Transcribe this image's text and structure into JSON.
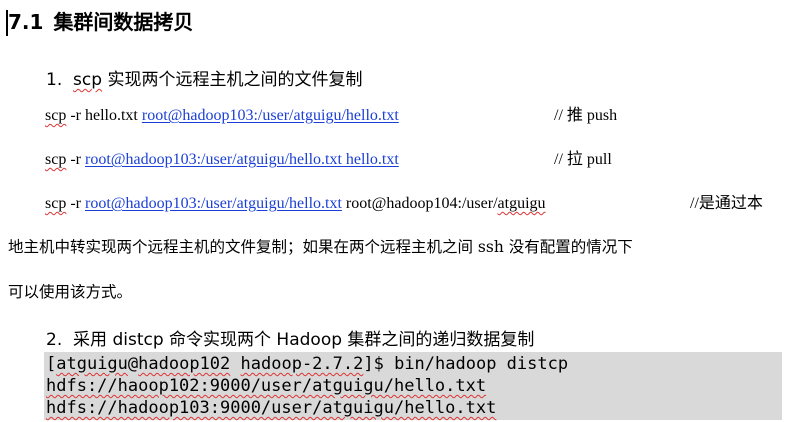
{
  "section": {
    "number": "7.1",
    "title": "集群间数据拷贝"
  },
  "sub1": {
    "num": "1.",
    "prefix": "scp",
    "rest": " 实现两个远程主机之间的文件复制"
  },
  "line1": {
    "cmd": "scp",
    "opts": " -r hello.txt ",
    "link": "root@hadoop103:/user/atguigu/hello.txt",
    "comment": "//  推   push"
  },
  "line2": {
    "cmd": "scp",
    "opts": " -r ",
    "link": "root@hadoop103:/user/atguigu/hello.txt    hello.txt",
    "comment": "//  拉   pull"
  },
  "line3": {
    "cmd": "scp",
    "opts": " -r ",
    "link": "root@hadoop103:/user/atguigu/hello.txt",
    "dest_pre": " root@hadoop104:/user/",
    "dest_word": "atguigu",
    "comment": "//是通过本"
  },
  "para": {
    "line1": "地主机中转实现两个远程主机的文件复制；如果在两个远程主机之间 ssh 没有配置的情况下",
    "line2": "可以使用该方式。"
  },
  "sub2": {
    "num": "2.",
    "text": "采用 distcp 命令实现两个 Hadoop 集群之间的递归数据复制"
  },
  "code": {
    "prompt_user": "atguigu",
    "prompt_host": "hadoop102",
    "prompt_dir": "hadoop-2.7.2",
    "line1_cmd": "$  bin/hadoop distcp",
    "line2": "hdfs://haoop102:9000/user/atguigu/hello.txt",
    "line3": "hdfs://hadoop103:9000/user/atguigu/hello.txt"
  }
}
